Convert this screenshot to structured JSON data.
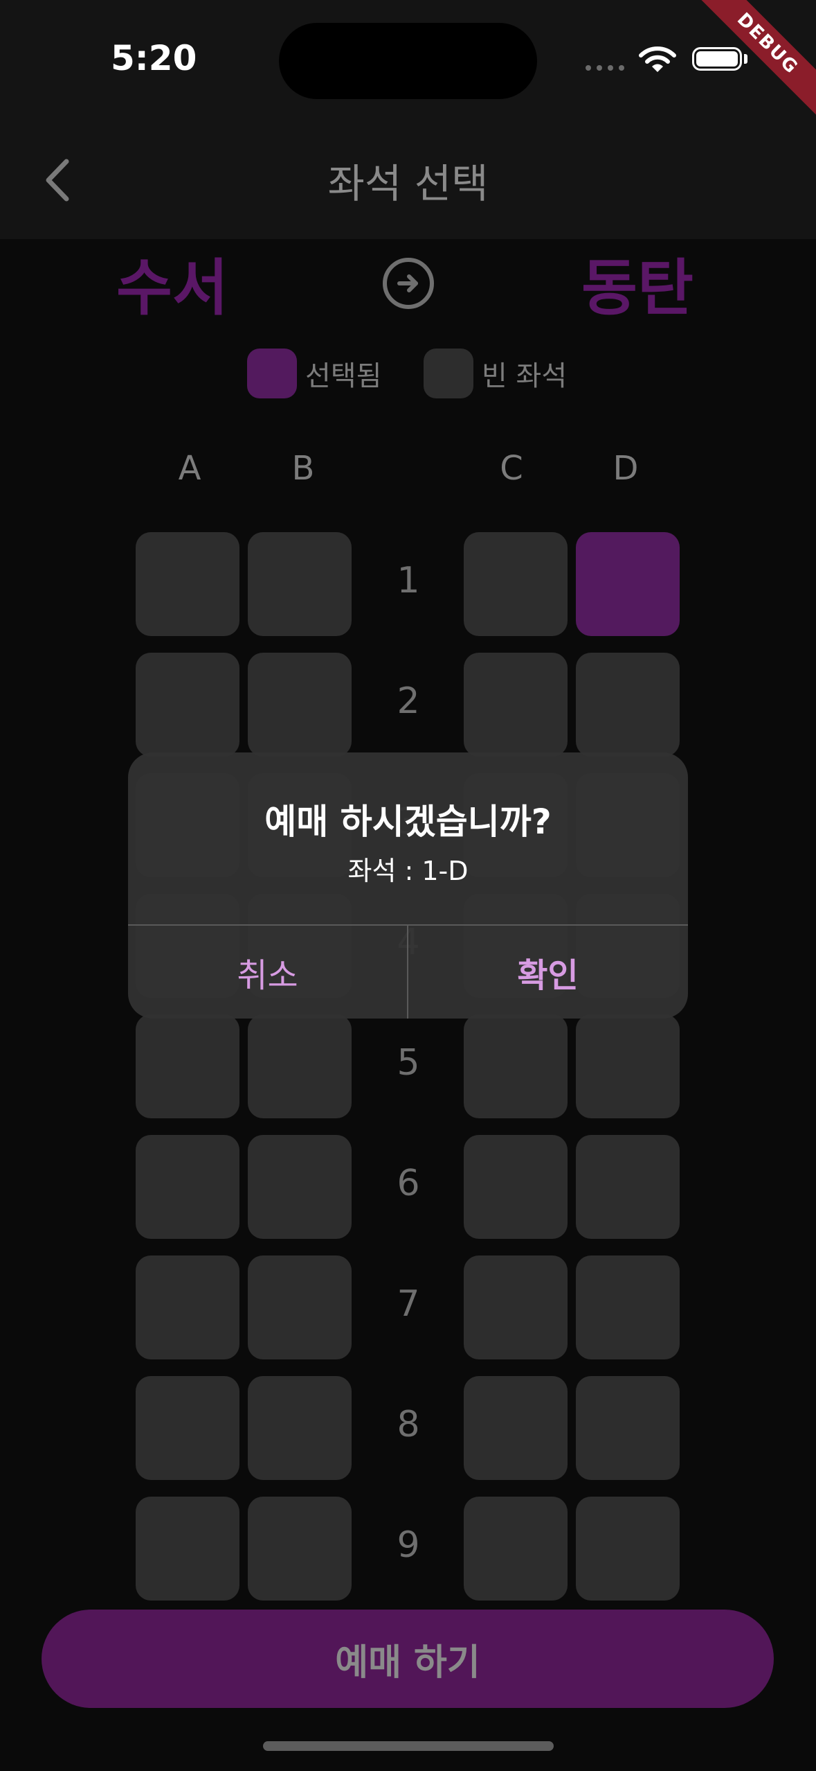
{
  "status": {
    "time": "5:20",
    "debug_label": "DEBUG"
  },
  "header": {
    "title": "좌석 선택",
    "back_icon": "chevron-left-icon"
  },
  "route": {
    "from": "수서",
    "to": "동탄",
    "arrow_icon": "arrow-right-circle-icon"
  },
  "legend": {
    "selected_label": "선택됨",
    "empty_label": "빈 좌석"
  },
  "colors": {
    "selected": "#531a5e",
    "empty": "#2d2d2d",
    "accent_text": "#d79be2",
    "button": "#521658"
  },
  "columns": [
    "A",
    "B",
    "C",
    "D"
  ],
  "rows": [
    "1",
    "2",
    "3",
    "4",
    "5",
    "6",
    "7",
    "8",
    "9"
  ],
  "selected_seat": "1-D",
  "dialog": {
    "title": "예매 하시겠습니까?",
    "message": "좌석 : 1-D",
    "cancel_label": "취소",
    "confirm_label": "확인"
  },
  "book_button": {
    "label": "예매 하기"
  }
}
